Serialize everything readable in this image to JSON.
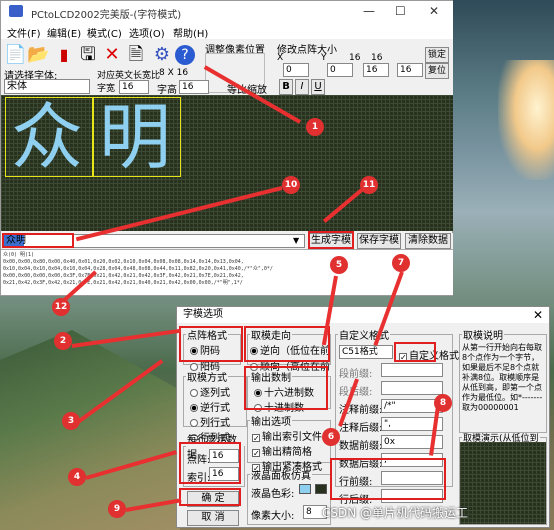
{
  "window": {
    "title": "PCtoLCD2002完美版-(字符模式)",
    "min": "—",
    "max": "☐",
    "close": "✕"
  },
  "menu": [
    "文件(F)",
    "编辑(E)",
    "模式(C)",
    "选项(O)",
    "帮助(H)"
  ],
  "toolbar": {
    "adjust_label": "调整像素位置",
    "dot_size_label": "修改点阵大小",
    "width_value": "16",
    "height_value": "16",
    "lock_label": "锁定",
    "reset_label": "复位",
    "font_label": "请选择字体:",
    "font_value": "宋体",
    "char_size_label": "对应英文长宽比",
    "ratio_value": "8 X 16",
    "width_label": "字宽",
    "width_val": "16",
    "height_label": "字高",
    "height_val": "16",
    "proportional_label": "等比缩放",
    "bold": "B",
    "italic": "I",
    "underline": "U",
    "x_label": "X",
    "y_label": "Y"
  },
  "glyphs": [
    "众",
    "明"
  ],
  "input": {
    "value": "众明",
    "btn_generate": "生成字模",
    "btn_save": "保存字模",
    "btn_clear": "清除数据"
  },
  "output": {
    "lines": [
      "众(0) 明(1)",
      "",
      "0x00,0x00,0x80,0x00,0x40,0x01,0x20,0x02,0x10,0x04,0x08,0x08,0x14,0x14,0x13,0x04,",
      "0x10,0x04,0x10,0x04,0x10,0x04,0x28,0x04,0x48,0x08,0x44,0x11,0x82,0x20,0x41,0x40,/*\"众\",0*/",
      "0x00,0x00,0x00,0x00,0x3F,0x7E,0x21,0x42,0x21,0x42,0x3F,0x42,0x21,0x7E,0x21,0x42,",
      "0x21,0x42,0x3F,0x42,0x21,0x7E,0x21,0x42,0x21,0x40,0x21,0x42,0x00,0x00,/*\"明\",1*/"
    ]
  },
  "dialog": {
    "title": "字模选项",
    "close": "✕",
    "dot_format": {
      "legend": "点阵格式",
      "options": [
        "阴码",
        "阳码"
      ],
      "selected": 0
    },
    "direction": {
      "legend": "取模走向",
      "options": [
        "逆向（低位在前",
        "顺向（高位在前"
      ],
      "selected": 0
    },
    "custom": {
      "legend": "自定义格式",
      "format_value": "C51格式",
      "custom_check": "自定义格式"
    },
    "modes": {
      "legend": "取模方式",
      "options": [
        "逐列式",
        "逆行式",
        "列行式",
        "行列式"
      ],
      "selected": 1
    },
    "radix": {
      "legend": "输出数制",
      "options": [
        "十六进制数",
        "十进制数"
      ],
      "selected": 0
    },
    "output_opts": {
      "legend": "输出选项",
      "options": [
        "输出索引文件",
        "输出精简格",
        "输出紧凑格式"
      ]
    },
    "per_row": {
      "legend": "每行显示数据",
      "dots_label": "点阵:",
      "dots_value": "16",
      "index_label": "索引:",
      "index_value": "16"
    },
    "fields": [
      {
        "label": "段前缀:",
        "value": ""
      },
      {
        "label": "段后缀:",
        "value": ""
      },
      {
        "label": "注释前缀:",
        "value": "/*\""
      },
      {
        "label": "注释后缀:",
        "value": "\","
      },
      {
        "label": "数据前缀:",
        "value": "0x"
      },
      {
        "label": "数据后缀:",
        "value": ","
      },
      {
        "label": "行前缀:",
        "value": ""
      },
      {
        "label": "行后缀:",
        "value": ""
      }
    ],
    "lcd_panel": {
      "legend": "液晶面板仿真",
      "color_label": "液晶色彩:",
      "pixel_label": "像素大小:",
      "pixel_value": "8"
    },
    "ok": "确  定",
    "cancel": "取  消",
    "help": {
      "legend": "取模说明",
      "text": "从第一行开始向右每取8个点作为一个字节，如果最后不足8个点就补满8位。取模顺序是从低到高，即第一个点作为最低位。如*------- 取为00000001"
    },
    "demo": {
      "legend": "取模演示(从低位到"
    }
  },
  "badges": [
    "1",
    "2",
    "3",
    "4",
    "5",
    "6",
    "7",
    "8",
    "9",
    "10",
    "11",
    "12"
  ],
  "watermark": "CSDN @单片机代码搬运工"
}
